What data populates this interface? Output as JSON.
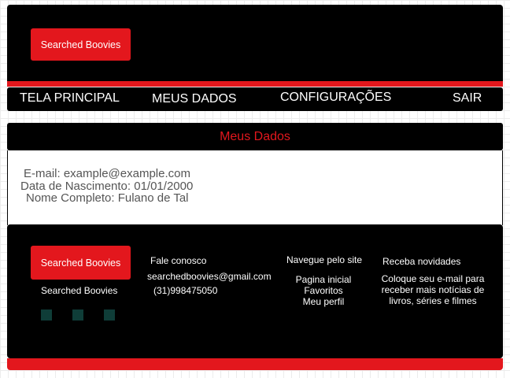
{
  "header": {
    "brand_button": "Searched Boovies"
  },
  "nav": {
    "items": [
      {
        "label": "TELA PRINCIPAL"
      },
      {
        "label": "MEUS DADOS"
      },
      {
        "label": "CONFIGURAÇÕES"
      },
      {
        "label": "SAIR"
      }
    ]
  },
  "section": {
    "title": "Meus Dados"
  },
  "profile": {
    "email": "E-mail: example@example.com",
    "birth_date": "Data de Nascimento: 01/01/2000",
    "full_name": "Nome Completo: Fulano de Tal"
  },
  "footer": {
    "brand_button": "Searched Boovies",
    "brand_name": "Searched Boovies",
    "contact": {
      "title": "Fale conosco",
      "email": "searchedboovies@gmail.com",
      "phone": "(31)998475050"
    },
    "navigation": {
      "title": "Navegue pelo site",
      "links": [
        "Pagina inicial",
        "Favoritos",
        "Meu perfil"
      ]
    },
    "newsletter": {
      "title": "Receba novidades",
      "lines": [
        "Coloque seu e-mail para",
        "receber mais notícias de",
        "livros, séries e filmes"
      ]
    },
    "social_icons": [
      "social-icon-1",
      "social-icon-2",
      "social-icon-3"
    ]
  },
  "colors": {
    "accent_red": "#e3171d",
    "background_dark": "#000000",
    "social_icon": "#0f3d38"
  }
}
